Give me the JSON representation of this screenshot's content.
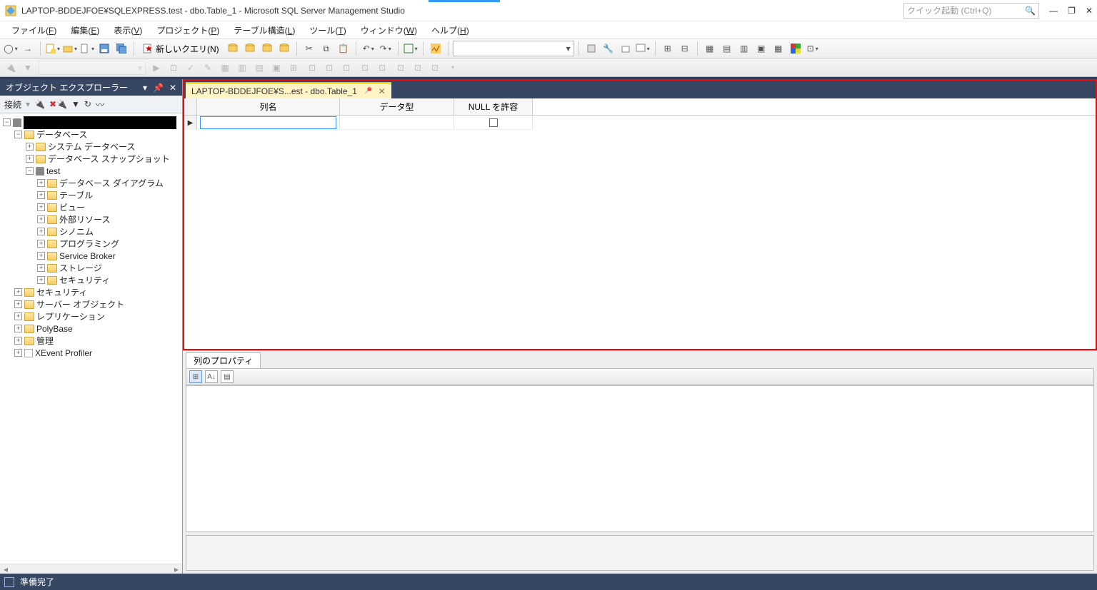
{
  "title": "LAPTOP-BDDEJFOE¥SQLEXPRESS.test - dbo.Table_1 - Microsoft SQL Server Management Studio",
  "quicklaunch_placeholder": "クイック起動 (Ctrl+Q)",
  "menu": {
    "file": {
      "pre": "ファイル(",
      "u": "F",
      "post": ")"
    },
    "edit": {
      "pre": "編集(",
      "u": "E",
      "post": ")"
    },
    "view": {
      "pre": "表示(",
      "u": "V",
      "post": ")"
    },
    "project": {
      "pre": "プロジェクト(",
      "u": "P",
      "post": ")"
    },
    "tdesign": {
      "pre": "テーブル構造(",
      "u": "L",
      "post": ")"
    },
    "tools": {
      "pre": "ツール(",
      "u": "T",
      "post": ")"
    },
    "window": {
      "pre": "ウィンドウ(",
      "u": "W",
      "post": ")"
    },
    "help": {
      "pre": "ヘルプ(",
      "u": "H",
      "post": ")"
    }
  },
  "toolbar": {
    "new_query": "新しいクエリ(N)"
  },
  "sidebar": {
    "title": "オブジェクト エクスプローラー",
    "connect": "接続",
    "server_hidden": "",
    "nodes": {
      "databases": "データベース",
      "sysdb": "システム データベース",
      "snap": "データベース スナップショット",
      "test": "test",
      "diag": "データベース ダイアグラム",
      "tables": "テーブル",
      "views": "ビュー",
      "ext": "外部リソース",
      "syn": "シノニム",
      "prog": "プログラミング",
      "sb": "Service Broker",
      "stor": "ストレージ",
      "sec": "セキュリティ",
      "sec2": "セキュリティ",
      "srvobj": "サーバー オブジェクト",
      "repl": "レプリケーション",
      "poly": "PolyBase",
      "mgmt": "管理",
      "xev": "XEvent Profiler"
    }
  },
  "tab_label": "LAPTOP-BDDEJFOE¥S...est - dbo.Table_1",
  "grid": {
    "col_name": "列名",
    "col_type": "データ型",
    "col_null": "NULL を許容",
    "row1_name": ""
  },
  "props_tab": "列のプロパティ",
  "status": "準備完了"
}
